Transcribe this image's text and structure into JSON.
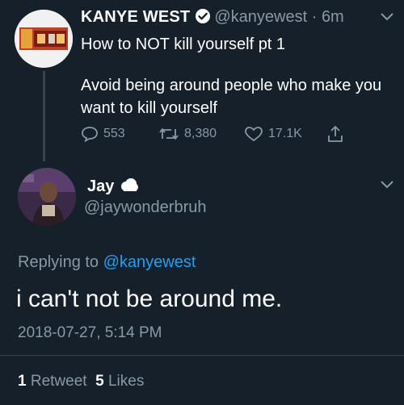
{
  "tweet": {
    "author_name": "KANYE WEST",
    "author_handle": "@kanyewest",
    "separator": "·",
    "time": "6m",
    "line1": "How to NOT kill yourself pt 1",
    "body": "Avoid being around people who make you want to kill yourself",
    "replies": "553",
    "retweets": "8,380",
    "likes": "17.1K"
  },
  "reply": {
    "author_name": "Jay",
    "author_handle": "@jaywonderbruh",
    "replying_prefix": "Replying to",
    "replying_to": "@kanyewest",
    "text": "i can't not be around me.",
    "timestamp": "2018-07-27, 5:14 PM",
    "retweet_count": "1",
    "retweet_label": "Retweet",
    "like_count": "5",
    "like_label": "Likes"
  },
  "colors": {
    "background": "#15202b",
    "text": "#ffffff",
    "muted": "#8899a6",
    "link": "#1da1f2"
  }
}
